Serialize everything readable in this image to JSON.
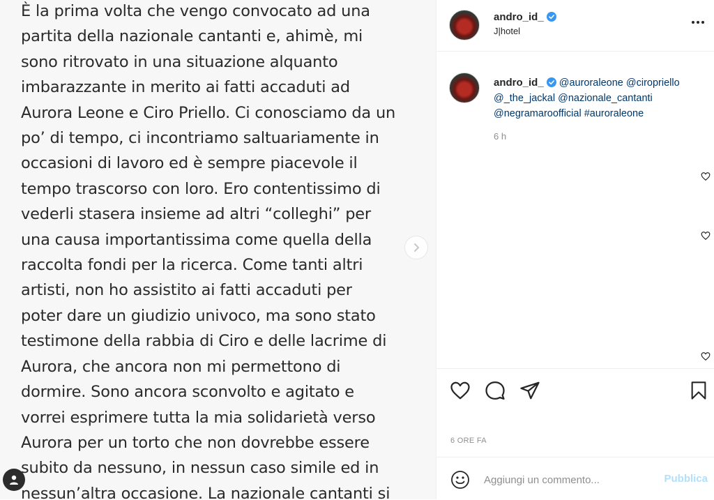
{
  "post_image": {
    "lines": [
      "È la prima volta che vengo convocato ad una",
      "partita della nazionale cantanti e, ahimè, mi",
      "sono ritrovato in una situazione alquanto",
      "imbarazzante in merito ai fatti accaduti ad",
      "Aurora Leone e Ciro Priello. Ci conosciamo da un",
      "po’ di tempo, ci incontriamo saltuariamente in",
      "occasioni di lavoro ed è sempre piacevole il",
      "tempo trascorso con loro. Ero contentissimo di",
      "vederli stasera insieme ad altri “colleghi” per",
      "una causa importantissima come quella della",
      "raccolta fondi per la ricerca. Come tanti altri",
      "artisti, non ho assistito ai fatti accaduti per",
      "poter dare un giudizio univoco, ma sono stato",
      "testimone della rabbia di Ciro e delle lacrime di",
      "Aurora, che ancora non mi permettono di",
      "dormire. Sono ancora sconvolto e agitato e",
      "vorrei esprimere tutta la mia solidarietà verso",
      "Aurora per un torto che non dovrebbe essere",
      "subito da nessuno, in nessun caso simile ed in",
      "nessun’altra occasione. La nazionale cantanti si"
    ],
    "next_icon": "chevron-right-icon",
    "user_icon": "user-icon"
  },
  "header": {
    "username": "andro_id_",
    "location": "J|hotel",
    "more_icon": "more-horizontal-icon"
  },
  "caption": {
    "username": "andro_id_",
    "mentions": [
      "@auroraleone",
      "@ciropriello",
      "@_the_jackal",
      "@nazionale_cantanti",
      "@negramaroofficial",
      "#auroraleone"
    ],
    "time": "6 h"
  },
  "actions": {
    "like_icon": "heart-icon",
    "comment_icon": "comment-icon",
    "share_icon": "paper-plane-icon",
    "save_icon": "bookmark-icon"
  },
  "timestamp": "6 ORE FA",
  "comment_box": {
    "placeholder": "Aggiungi un commento...",
    "publish_label": "Pubblica"
  },
  "colors": {
    "link": "#00376b",
    "publish_disabled": "#b2dffc",
    "verified": "#3897f0",
    "secondary_text": "#8e8e8e"
  }
}
